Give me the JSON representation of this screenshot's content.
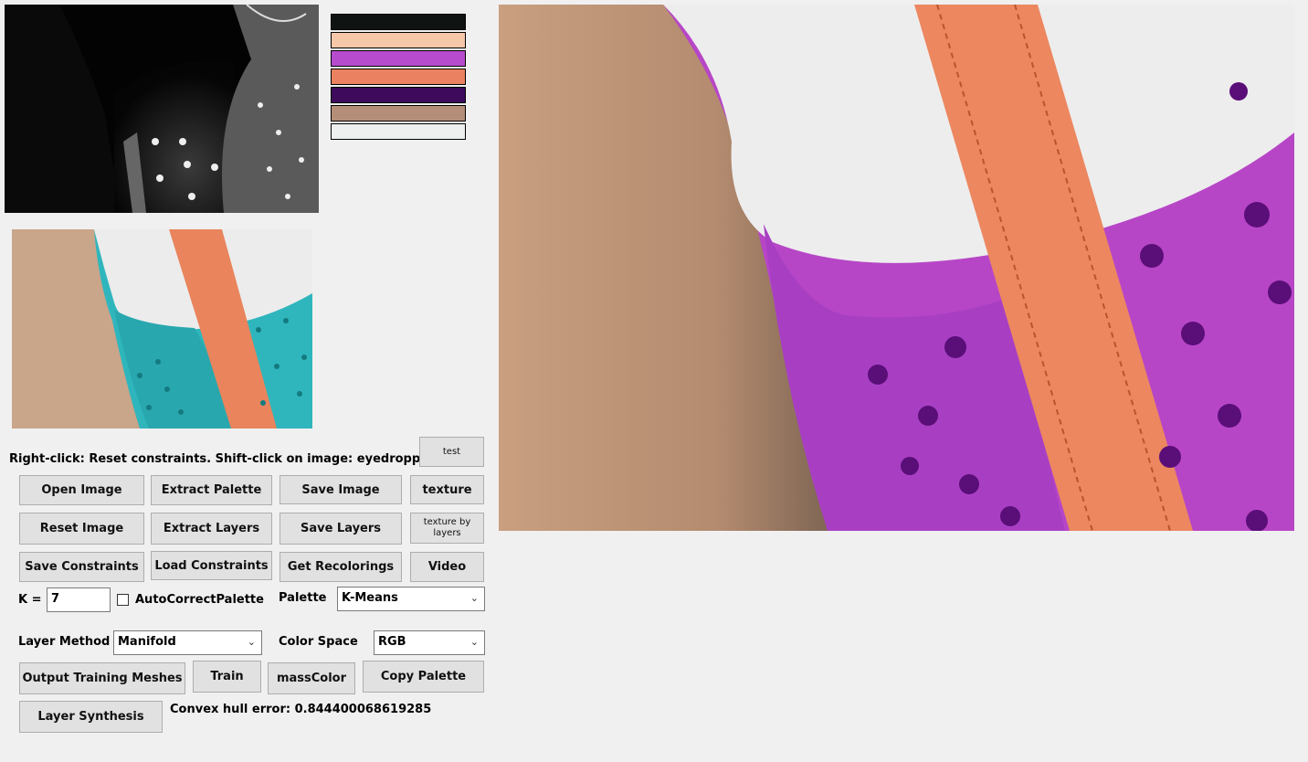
{
  "palette": {
    "colors": [
      "#0f1412",
      "#f6c7a8",
      "#b64ccd",
      "#ea8261",
      "#3e0a5b",
      "#b48e78",
      "#eef0f0"
    ]
  },
  "instructions": "Right-click: Reset constraints.  Shift-click on image: eyedropper",
  "buttons": {
    "test": "test",
    "open_image": "Open Image",
    "extract_palette": "Extract Palette",
    "save_image": "Save Image",
    "texture": "texture",
    "reset_image": "Reset Image",
    "extract_layers": "Extract Layers",
    "save_layers": "Save Layers",
    "texture_by_layers": "texture by layers",
    "save_constraints": "Save Constraints",
    "load_constraints": "Load Constraints",
    "get_recolorings": "Get Recolorings",
    "video": "Video",
    "output_training_meshes": "Output Training Meshes",
    "train": "Train",
    "mass_color": "massColor",
    "copy_palette": "Copy Palette",
    "layer_synthesis": "Layer Synthesis"
  },
  "k": {
    "label": "K =",
    "value": "7"
  },
  "autocorrect": {
    "label": "AutoCorrectPalette",
    "checked": false
  },
  "palette_method": {
    "label": "Palette",
    "value": "K-Means"
  },
  "layer_method": {
    "label": "Layer Method",
    "value": "Manifold"
  },
  "color_space": {
    "label": "Color Space",
    "value": "RGB"
  },
  "status": "Convex hull error: 0.844400068619285",
  "icons": {
    "dropdown": "chevron-down-icon"
  }
}
